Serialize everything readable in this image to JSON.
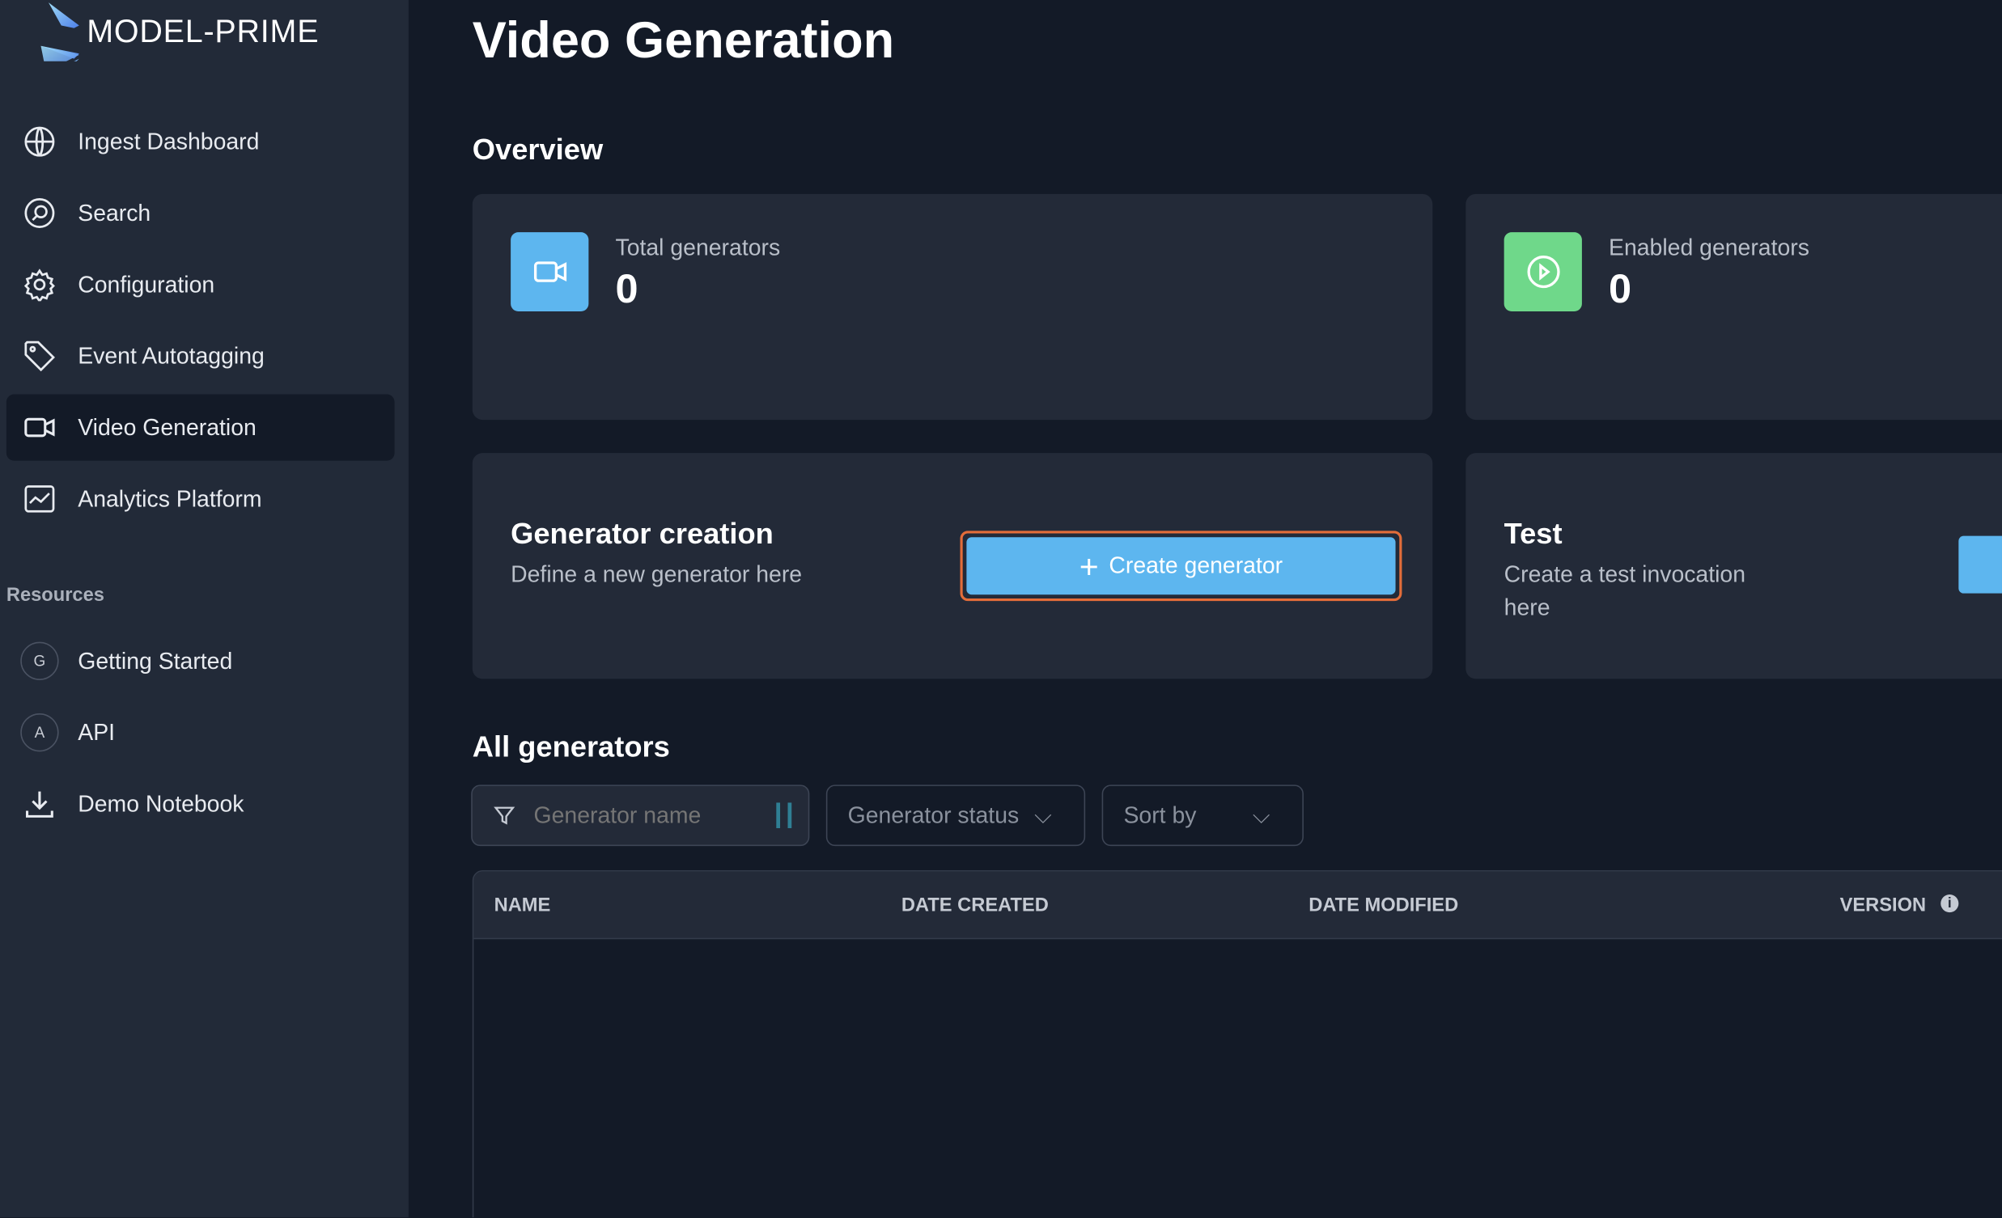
{
  "brand": {
    "name": "MODEL-PRIME"
  },
  "sidebar": {
    "items": [
      {
        "label": "Ingest Dashboard",
        "icon": "globe-icon"
      },
      {
        "label": "Search",
        "icon": "search-icon"
      },
      {
        "label": "Configuration",
        "icon": "gear-icon"
      },
      {
        "label": "Event Autotagging",
        "icon": "tag-icon"
      },
      {
        "label": "Video Generation",
        "icon": "video-icon",
        "active": true
      },
      {
        "label": "Analytics Platform",
        "icon": "chart-icon"
      }
    ],
    "resources_title": "Resources",
    "resources": [
      {
        "label": "Getting Started",
        "badge": "G"
      },
      {
        "label": "API",
        "badge": "A"
      },
      {
        "label": "Demo Notebook",
        "icon": "download-icon"
      }
    ]
  },
  "page": {
    "title": "Video Generation",
    "overview_title": "Overview",
    "all_title": "All generators"
  },
  "stats": [
    {
      "label": "Total generators",
      "value": "0",
      "color": "#5db6ef"
    },
    {
      "label": "Enabled generators",
      "value": "0",
      "color": "#6fd88a"
    }
  ],
  "actions": [
    {
      "title": "Generator creation",
      "desc": "Define a new generator here",
      "button": "Create generator"
    },
    {
      "title": "Test",
      "desc": "Create a test invocation here"
    }
  ],
  "filters": {
    "name_placeholder": "Generator name",
    "status": "Generator status",
    "sort": "Sort by"
  },
  "table": {
    "columns": [
      "NAME",
      "DATE CREATED",
      "DATE MODIFIED",
      "VERSION"
    ]
  },
  "colors": {
    "accent": "#5db6ef",
    "focus_outline": "#e36d3a",
    "sidebar_bg": "#222a38",
    "main_bg": "#131a27"
  }
}
